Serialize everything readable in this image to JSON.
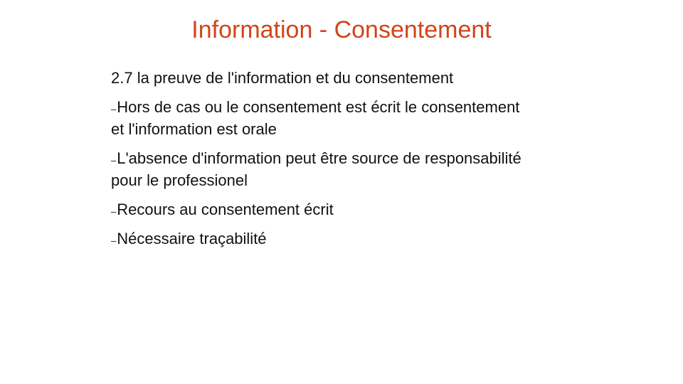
{
  "slide": {
    "title": "Information - Consentement",
    "title_color": "#d2441a",
    "heading": "2.7 la preuve de l'information et du consentement",
    "bullet_glyph": "–",
    "bullets": [
      {
        "text": "Hors de cas ou le consentement est écrit le consentement et l'information est orale"
      },
      {
        "text": "L'absence d'information peut être source de responsabilité pour le professionel"
      },
      {
        "text": "Recours au consentement écrit"
      },
      {
        "text": "Nécessaire traçabilité"
      }
    ]
  }
}
